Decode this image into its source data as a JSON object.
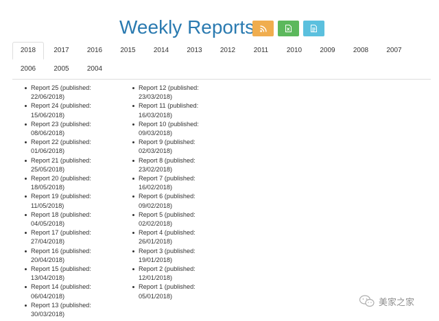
{
  "header": {
    "title": "Weekly Reports",
    "buttons": [
      {
        "icon": "rss-icon",
        "color": "#f0ad4e"
      },
      {
        "icon": "excel-file-icon",
        "color": "#5cb85c"
      },
      {
        "icon": "document-file-icon",
        "color": "#5bc0de"
      }
    ]
  },
  "tabs": {
    "active": "2018",
    "row1": [
      "2018",
      "2017",
      "2016",
      "2015",
      "2014",
      "2013",
      "2012",
      "2011",
      "2010",
      "2009",
      "2008",
      "2007"
    ],
    "row2": [
      "2006",
      "2005",
      "2004"
    ]
  },
  "reports": {
    "column1": [
      {
        "name": "Report 25 (published:",
        "date": "22/06/2018)"
      },
      {
        "name": "Report 24 (published:",
        "date": "15/06/2018)"
      },
      {
        "name": "Report 23 (published:",
        "date": "08/06/2018)"
      },
      {
        "name": "Report 22 (published:",
        "date": "01/06/2018)"
      },
      {
        "name": "Report 21 (published:",
        "date": "25/05/2018)"
      },
      {
        "name": "Report 20 (published:",
        "date": "18/05/2018)"
      },
      {
        "name": "Report 19 (published:",
        "date": "11/05/2018)"
      },
      {
        "name": "Report 18 (published:",
        "date": "04/05/2018)"
      },
      {
        "name": "Report 17 (published:",
        "date": "27/04/2018)"
      },
      {
        "name": "Report 16 (published:",
        "date": "20/04/2018)"
      },
      {
        "name": "Report 15 (published:",
        "date": "13/04/2018)"
      },
      {
        "name": "Report 14 (published:",
        "date": "06/04/2018)"
      },
      {
        "name": "Report 13 (published:",
        "date": "30/03/2018)"
      }
    ],
    "column2": [
      {
        "name": "Report 12 (published:",
        "date": "23/03/2018)"
      },
      {
        "name": "Report 11 (published:",
        "date": "16/03/2018)"
      },
      {
        "name": "Report 10 (published:",
        "date": "09/03/2018)"
      },
      {
        "name": "Report 9 (published:",
        "date": "02/03/2018)"
      },
      {
        "name": "Report 8 (published:",
        "date": "23/02/2018)"
      },
      {
        "name": "Report 7 (published:",
        "date": "16/02/2018)"
      },
      {
        "name": "Report 6 (published:",
        "date": "09/02/2018)"
      },
      {
        "name": "Report 5 (published:",
        "date": "02/02/2018)"
      },
      {
        "name": "Report 4 (published:",
        "date": "26/01/2018)"
      },
      {
        "name": "Report 3 (published:",
        "date": "19/01/2018)"
      },
      {
        "name": "Report 2 (published:",
        "date": "12/01/2018)"
      },
      {
        "name": "Report 1 (published:",
        "date": "05/01/2018)"
      }
    ]
  },
  "watermark": {
    "text": "美家之家",
    "icon": "wechat-icon"
  }
}
